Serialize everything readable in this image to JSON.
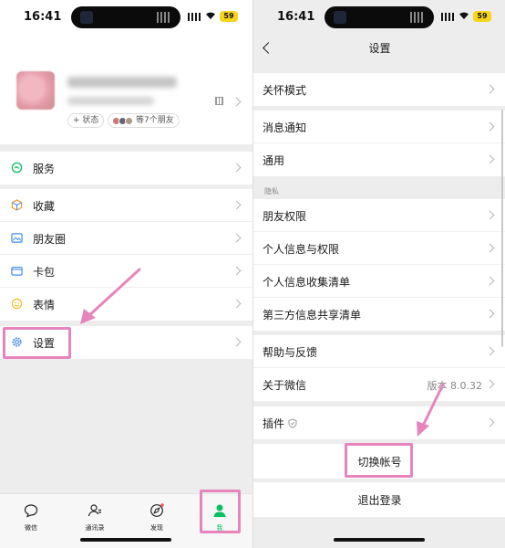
{
  "status_bar": {
    "time": "16:41",
    "battery": "59"
  },
  "profile": {
    "status_label": "+ 状态",
    "friends_label": "等7个朋友"
  },
  "me_menu": [
    {
      "label": "服务",
      "icon": "service-icon"
    },
    {
      "label": "收藏",
      "icon": "favorites-icon"
    },
    {
      "label": "朋友圈",
      "icon": "moments-icon"
    },
    {
      "label": "卡包",
      "icon": "card-wallet-icon"
    },
    {
      "label": "表情",
      "icon": "sticker-icon"
    },
    {
      "label": "设置",
      "icon": "settings-gear-icon"
    }
  ],
  "tabbar": {
    "items": [
      {
        "label": "微信",
        "icon": "chat-icon"
      },
      {
        "label": "通讯录",
        "icon": "contacts-icon"
      },
      {
        "label": "发现",
        "icon": "discover-icon"
      },
      {
        "label": "我",
        "icon": "me-icon"
      }
    ],
    "active_color": "#07c160"
  },
  "settings": {
    "title": "设置",
    "rows": {
      "care_mode": "关怀模式",
      "notifications": "消息通知",
      "general": "通用",
      "privacy_group": "隐私",
      "friend_permissions": "朋友权限",
      "personal_info": "个人信息与权限",
      "info_collection": "个人信息收集清单",
      "third_party": "第三方信息共享清单",
      "help": "帮助与反馈",
      "about": "关于微信",
      "version": "版本 8.0.32",
      "plugins": "插件",
      "switch_account": "切换帐号",
      "logout": "退出登录"
    }
  },
  "colors": {
    "highlight": "#e884bd",
    "accent_green": "#07c160"
  }
}
